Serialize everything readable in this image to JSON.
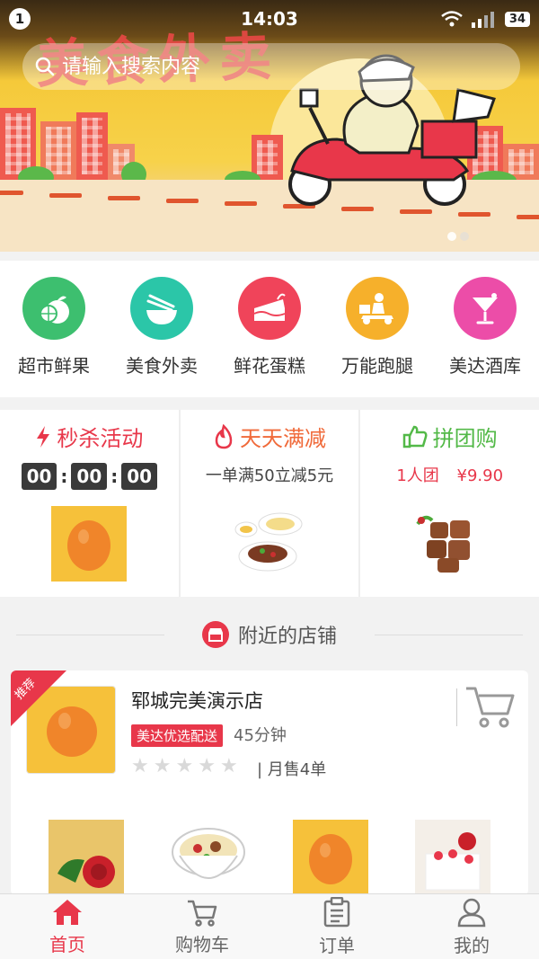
{
  "status_bar": {
    "notification_count": "1",
    "time": "14:03",
    "battery": "34"
  },
  "banner": {
    "title": "美食外卖",
    "search_placeholder": "请输入搜索内容"
  },
  "categories": [
    {
      "label": "超市鲜果",
      "icon": "fruit-icon",
      "color": "#3dbf6f"
    },
    {
      "label": "美食外卖",
      "icon": "bowl-icon",
      "color": "#2bc6a8"
    },
    {
      "label": "鲜花蛋糕",
      "icon": "cake-icon",
      "color": "#f0445a"
    },
    {
      "label": "万能跑腿",
      "icon": "delivery-icon",
      "color": "#f6b02b"
    },
    {
      "label": "美达酒库",
      "icon": "cocktail-icon",
      "color": "#ec4da8"
    }
  ],
  "promos": {
    "flash": {
      "title": "秒杀活动",
      "countdown": [
        "00",
        "00",
        "00"
      ],
      "color": "#e8374a"
    },
    "discount": {
      "title": "天天满减",
      "subtitle": "一单满50立减5元",
      "color": "#f06a3a"
    },
    "group": {
      "title": "拼团购",
      "group_size": "1人团",
      "price": "¥9.90",
      "color": "#53b948"
    }
  },
  "nearby": {
    "title": "附近的店铺"
  },
  "store": {
    "ribbon": "推荐",
    "name": "郓城完美演示店",
    "tag": "美达优选配送",
    "delivery_time": "45分钟",
    "rating": 0,
    "monthly_sales": "| 月售4单"
  },
  "bottom_nav": [
    {
      "label": "首页",
      "icon": "home-icon",
      "active": true
    },
    {
      "label": "购物车",
      "icon": "cart-icon",
      "active": false
    },
    {
      "label": "订单",
      "icon": "order-icon",
      "active": false
    },
    {
      "label": "我的",
      "icon": "user-icon",
      "active": false
    }
  ],
  "colors": {
    "accent": "#e8374a"
  }
}
